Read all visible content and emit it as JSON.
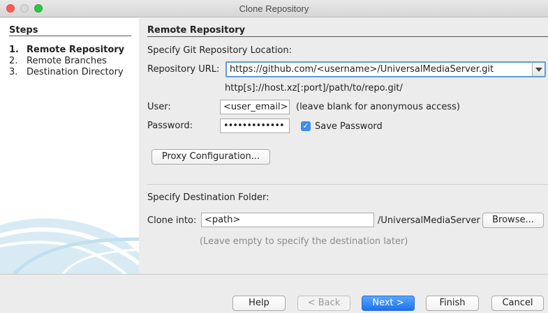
{
  "window": {
    "title": "Clone Repository"
  },
  "steps": {
    "title": "Steps",
    "items": [
      {
        "num": "1.",
        "label": "Remote Repository"
      },
      {
        "num": "2.",
        "label": "Remote Branches"
      },
      {
        "num": "3.",
        "label": "Destination Directory"
      }
    ]
  },
  "remote": {
    "section_title": "Remote Repository",
    "location_label": "Specify Git Repository Location:",
    "url_label": "Repository URL:",
    "url_value": "https://github.com/<username>/UniversalMediaServer.git",
    "url_hint": "http[s]://host.xz[:port]/path/to/repo.git/",
    "user_label": "User:",
    "user_value": "<user_email>",
    "user_hint": "(leave blank for anonymous access)",
    "password_label": "Password:",
    "password_value": "•••••••••••••",
    "save_password_label": "Save Password",
    "save_password_checked": true,
    "proxy_button": "Proxy Configuration..."
  },
  "destination": {
    "section_label": "Specify Destination Folder:",
    "clone_into_label": "Clone into:",
    "path_value": "<path>",
    "suffix": "/UniversalMediaServer",
    "browse_button": "Browse...",
    "hint": "(Leave empty to specify the destination later)"
  },
  "footer": {
    "help": "Help",
    "back": "< Back",
    "next": "Next >",
    "finish": "Finish",
    "cancel": "Cancel"
  },
  "colors": {
    "accent": "#1a73ec",
    "focus": "#5d9be0"
  }
}
